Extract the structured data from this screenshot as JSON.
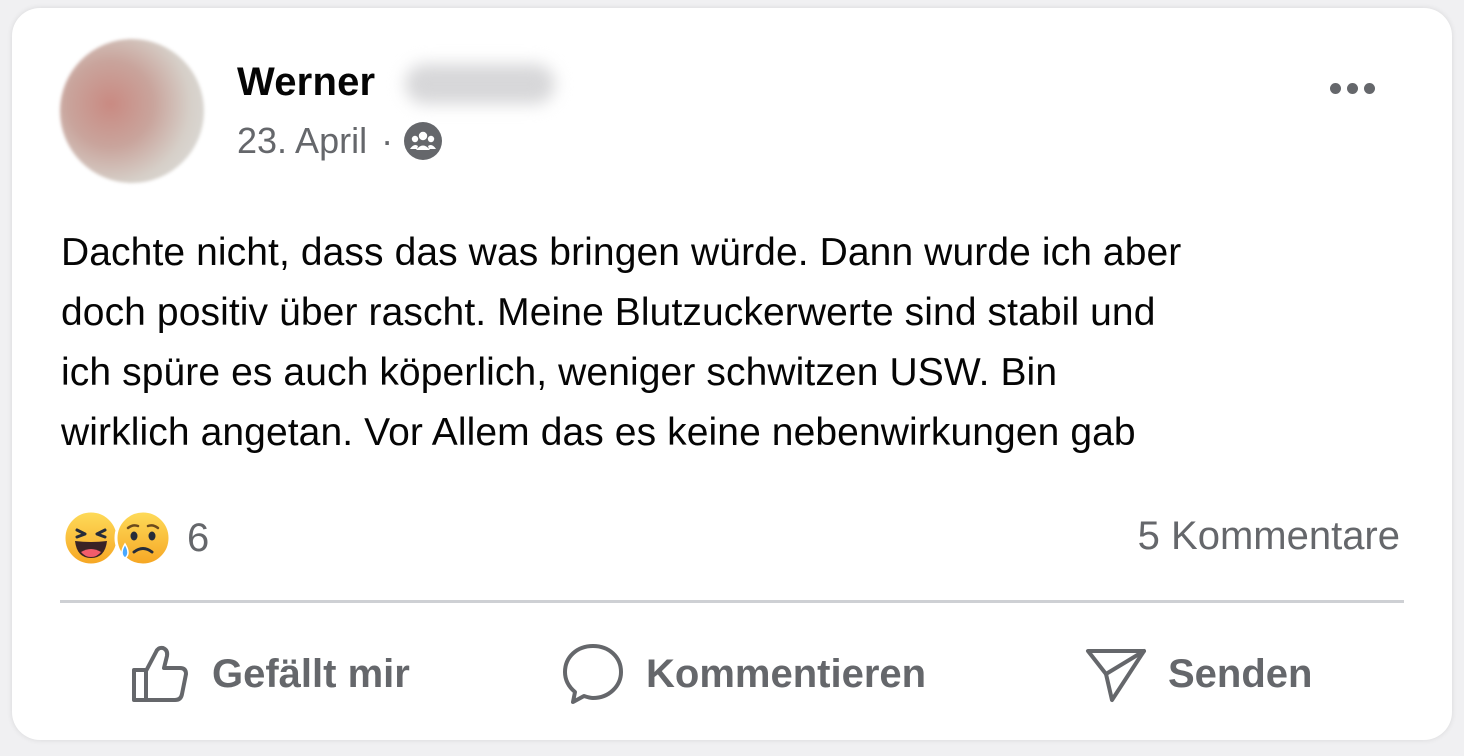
{
  "post": {
    "author_name": "Werner",
    "date": "23. April",
    "separator": "·",
    "audience_icon": "group-icon",
    "more_icon": "more-horizontal-icon",
    "text": "Dachte nicht, dass das was bringen würde. Dann wurde ich aber\ndoch positiv über rascht. Meine Blutzuckerwerte sind stabil und\nich spüre es auch köperlich, weniger schwitzen USW. Bin\nwirklich angetan. Vor Allem das es keine nebenwirkungen gab"
  },
  "reactions": {
    "icons": [
      "haha-reaction-icon",
      "sad-reaction-icon"
    ],
    "count": "6"
  },
  "comments": {
    "label": "5 Kommentare"
  },
  "actions": {
    "like_label": "Gefällt mir",
    "comment_label": "Kommentieren",
    "send_label": "Senden"
  },
  "colors": {
    "text_primary": "#050505",
    "text_secondary": "#65676b",
    "divider": "#ced0d4",
    "card_background": "#ffffff"
  }
}
